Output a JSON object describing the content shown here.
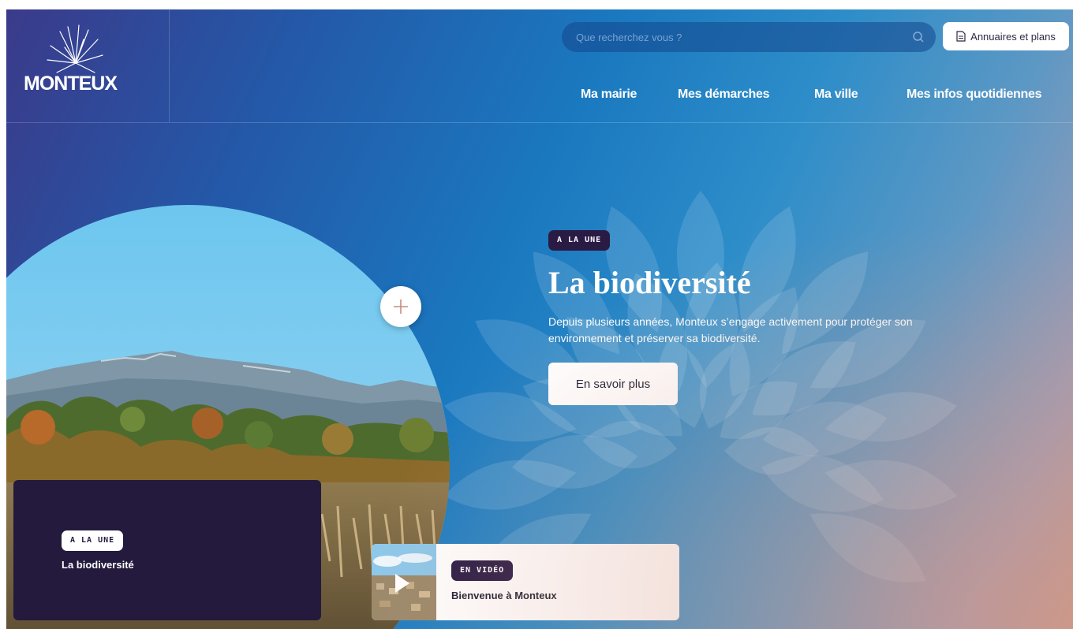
{
  "brand": {
    "logo_text": "MONTEUX"
  },
  "search": {
    "placeholder": "Que recherchez vous ?"
  },
  "header": {
    "directory_label": "Annuaires et plans"
  },
  "nav": {
    "items": [
      {
        "label": "Ma mairie"
      },
      {
        "label": "Mes démarches"
      },
      {
        "label": "Ma ville"
      },
      {
        "label": "Mes infos quotidiennes"
      }
    ]
  },
  "hero": {
    "badge": "A LA UNE",
    "title": "La biodiversité",
    "description": "Depuis plusieurs années, Monteux s’engage activement pour protéger son environnement et préserver sa biodiversité.",
    "cta_label": "En savoir plus"
  },
  "cards": {
    "featured": {
      "badge": "A LA UNE",
      "title": "La biodiversité"
    },
    "video": {
      "badge": "EN VIDÉO",
      "title": "Bienvenue à Monteux"
    }
  },
  "colors": {
    "badge_dark": "#2a1b45",
    "card_dark": "#231a3d",
    "accent_plus": "#c98a7a"
  },
  "icons": {
    "search": "search-icon",
    "document": "document-icon",
    "plus": "plus-icon",
    "play": "play-icon",
    "logo": "firework-logo-icon"
  }
}
